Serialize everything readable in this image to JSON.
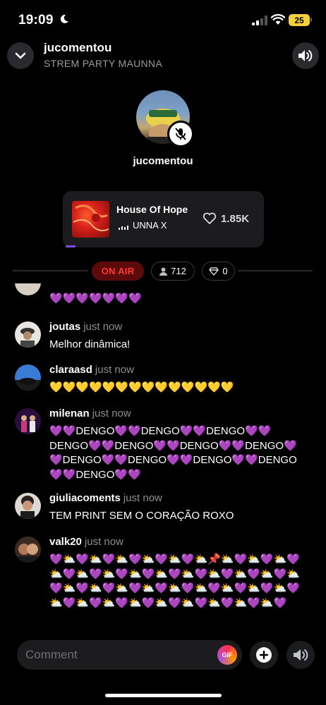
{
  "status_bar": {
    "time": "19:09",
    "battery": "25"
  },
  "header": {
    "title": "jucomentou",
    "subtitle": "STREM PARTY MAUNNA"
  },
  "host": {
    "name": "jucomentou"
  },
  "now_playing": {
    "song": "House Of Hope",
    "artist": "UNNA X",
    "likes": "1.85K"
  },
  "room_stats": {
    "status": "ON AIR",
    "listeners": "712",
    "gems": "0"
  },
  "messages": [
    {
      "user": "",
      "time": "",
      "text": "💜💜💜💜💜💜💜"
    },
    {
      "user": "joutas",
      "time": "just now",
      "text": "Melhor dinâmica!"
    },
    {
      "user": "claraasd",
      "time": "just now",
      "text": "💛💛💛💛💛💛💛💛💛💛💛💛💛💛"
    },
    {
      "user": "milenan",
      "time": "just now",
      "text": "💜💜DENGO💜💜DENGO💜💜DENGO💜💜DENGO💜💜DENGO💜💜DENGO💜💜DENGO💜💜DENGO💜💜DENGO💜💜DENGO💜💜DENGO💜💜DENGO💜💜"
    },
    {
      "user": "giuliacoments",
      "time": "just now",
      "text": "TEM PRINT SEM O CORAÇÃO ROXO"
    },
    {
      "user": "valk20",
      "time": "just now",
      "text": "💜⛅💜⛅💜⛅💜⛅💜⛅💜⛅📌⛅💜⛅💜⛅💜⛅💜⛅💜⛅💜⛅💜⛅💜⛅💜⛅💜⛅💜⛅💜⛅💜⛅💜⛅💜⛅💜⛅💜⛅💜⛅💜⛅💜⛅💜⛅💜⛅💜⛅💜⛅💜⛅💜⛅💜⛅💜⛅💜⛅💜⛅💜"
    }
  ],
  "composer": {
    "placeholder": "Comment",
    "gif_label": "GIF"
  },
  "colors": {
    "accent_red": "#ff3b30",
    "accent_purple": "#7b4dff",
    "battery": "#f4d03f"
  },
  "icons": [
    "moon-icon",
    "signal-icon",
    "wifi-icon",
    "chevron-down-icon",
    "speaker-icon",
    "mic-off-icon",
    "heart-icon",
    "person-icon",
    "diamond-icon",
    "plus-icon",
    "speaker-low-icon"
  ]
}
